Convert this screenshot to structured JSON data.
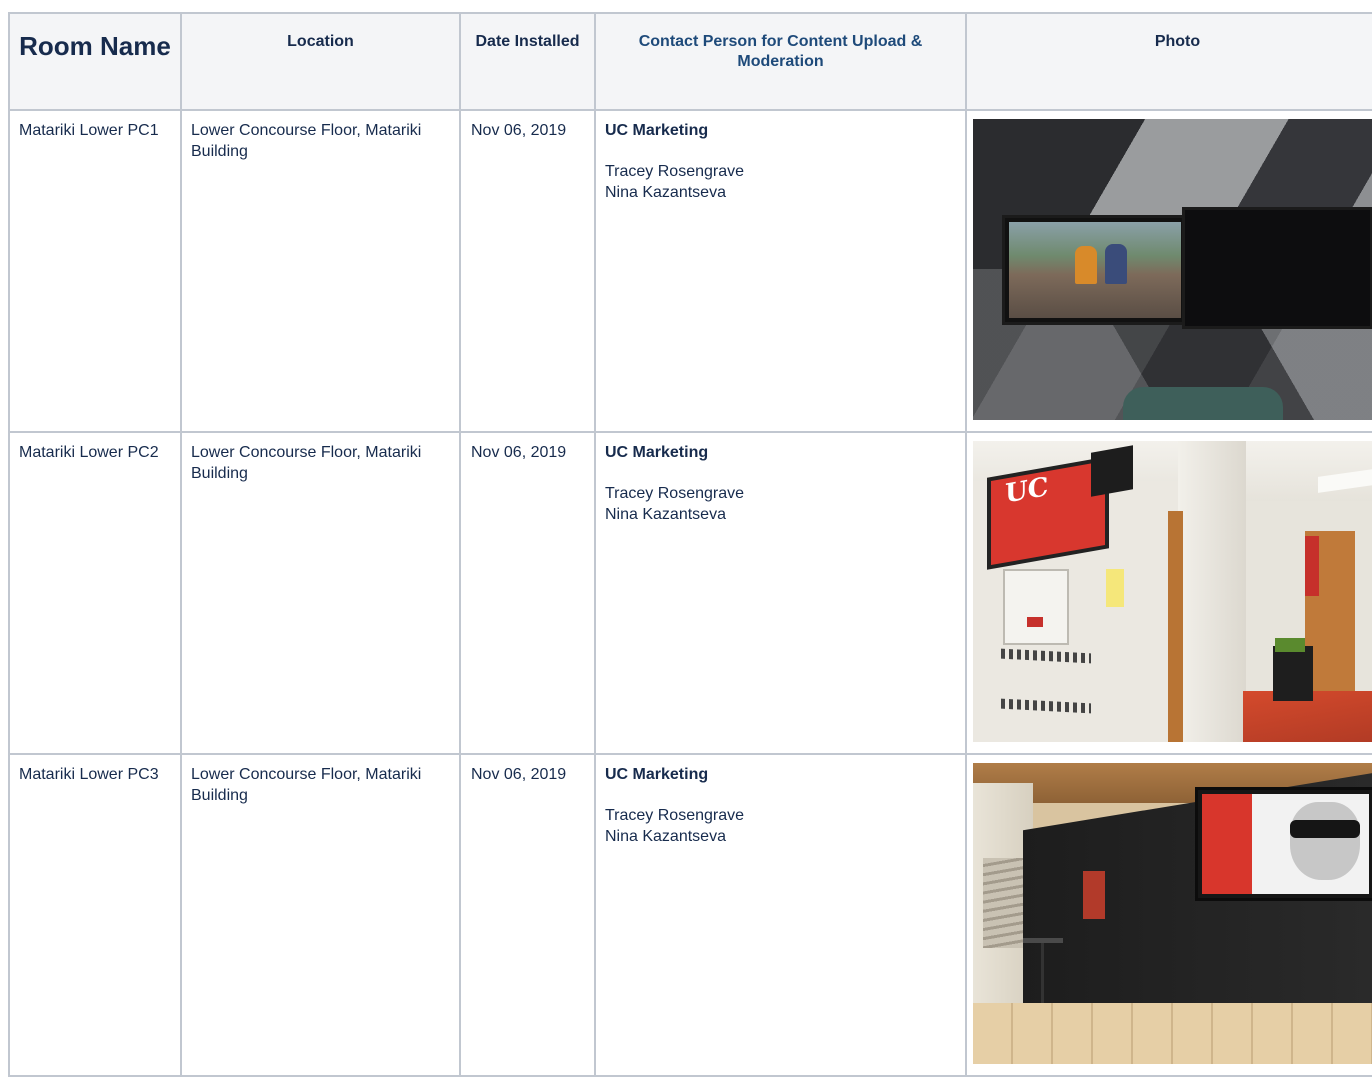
{
  "headers": {
    "room_name": "Room Name",
    "location": "Location",
    "date_installed": "Date Installed",
    "contact": "Contact Person for Content Upload & Moderation",
    "photo": "Photo"
  },
  "rows": [
    {
      "room": "Matariki Lower PC1",
      "location": "Lower Concourse Floor, Matariki Building",
      "date": "Nov 06, 2019",
      "org": "UC Marketing",
      "contacts": [
        "Tracey Rosengrave",
        "Nina Kazantseva"
      ],
      "photo": "wall-mounted-screens-photo"
    },
    {
      "room": "Matariki Lower PC2",
      "location": "Lower Concourse Floor, Matariki Building",
      "date": "Nov 06, 2019",
      "org": "UC Marketing",
      "contacts": [
        "Tracey Rosengrave",
        "Nina Kazantseva"
      ],
      "photo": "hallway-screen-photo"
    },
    {
      "room": "Matariki Lower PC3",
      "location": "Lower Concourse Floor, Matariki Building",
      "date": "Nov 06, 2019",
      "org": "UC Marketing",
      "contacts": [
        "Tracey Rosengrave",
        "Nina Kazantseva"
      ],
      "photo": "black-wall-screen-photo"
    }
  ],
  "photo_texts": {
    "uc_logo": "UC"
  },
  "colors": {
    "header_bg": "#f4f5f7",
    "border": "#c1c7d0",
    "text": "#172b4d",
    "contact_header": "#1e4a7a"
  }
}
